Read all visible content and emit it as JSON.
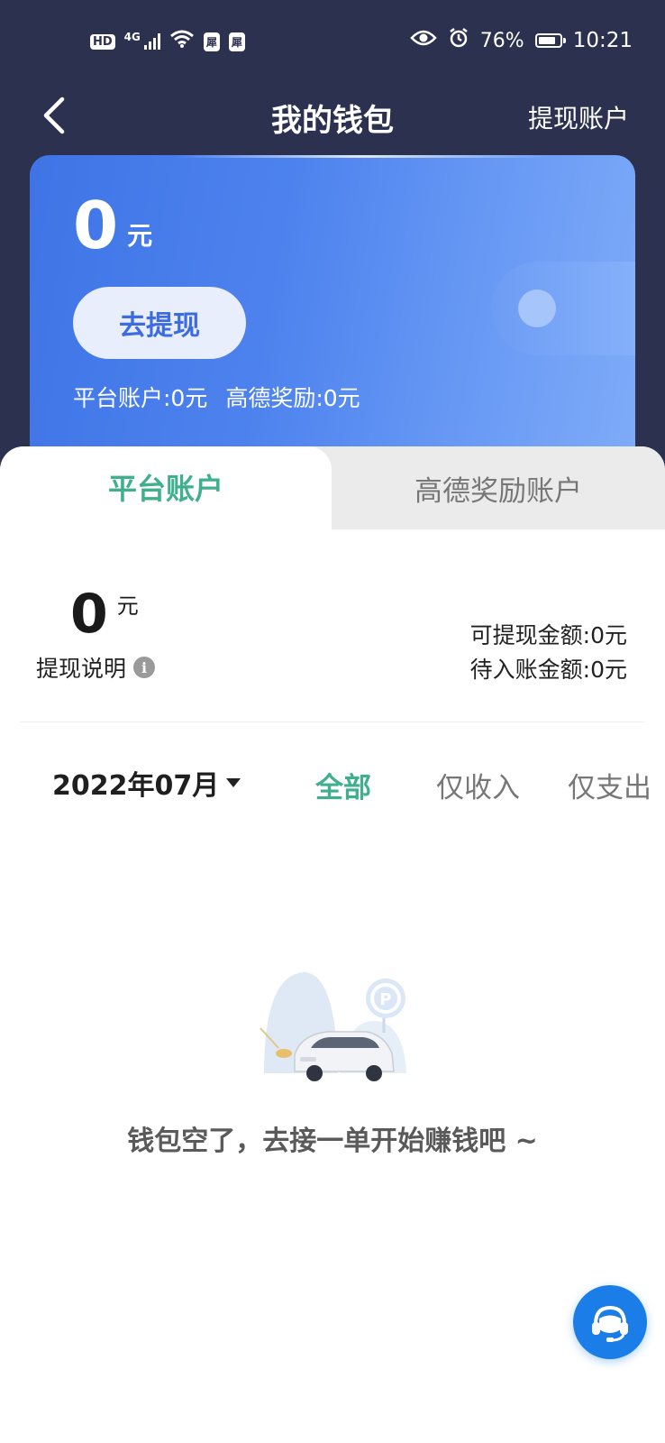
{
  "status_bar": {
    "hd": "HD",
    "network": "4G",
    "app_badge_1": "犀",
    "app_badge_2": "犀",
    "battery": "76%",
    "time": "10:21"
  },
  "nav": {
    "title": "我的钱包",
    "right_link": "提现账户"
  },
  "card": {
    "amount": "0",
    "unit": "元",
    "withdraw_button": "去提现",
    "platform_summary": "平台账户:0元",
    "gaode_summary": "高德奖励:0元"
  },
  "tabs": [
    {
      "label": "平台账户",
      "active": true
    },
    {
      "label": "高德奖励账户",
      "active": false
    }
  ],
  "account": {
    "amount": "0",
    "unit": "元",
    "withdraw_note": "提现说明",
    "withdrawable": "可提现金额:0元",
    "pending": "待入账金额:0元"
  },
  "filter": {
    "month": "2022年07月",
    "all": "全部",
    "income_only": "仅收入",
    "expense_only": "仅支出"
  },
  "empty": {
    "message": "钱包空了，去接一单开始赚钱吧 ~"
  },
  "colors": {
    "header": "#2c3150",
    "card": "#4d82ee",
    "accent_green": "#3fb08b",
    "service_blue": "#1b7de8"
  }
}
